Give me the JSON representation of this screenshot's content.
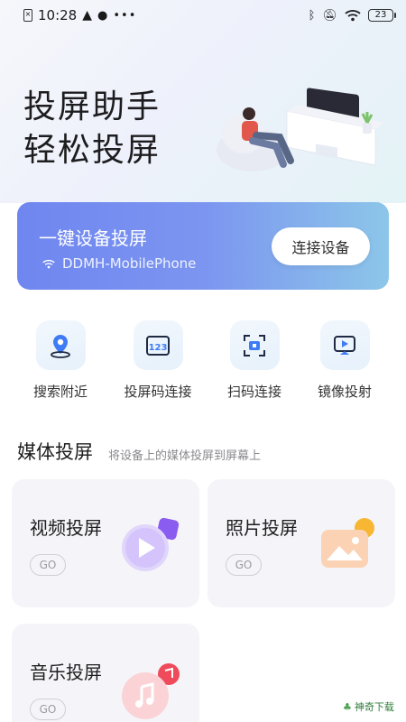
{
  "status_bar": {
    "time": "10:28",
    "battery": "23"
  },
  "hero": {
    "title_line1": "投屏助手",
    "title_line2": "轻松投屏"
  },
  "banner": {
    "title": "一键设备投屏",
    "device": "DDMH-MobilePhone",
    "connect_button": "连接设备"
  },
  "actions": [
    {
      "label": "搜索附近",
      "icon": "location-pin-icon"
    },
    {
      "label": "投屏码连接",
      "icon": "code-123-icon"
    },
    {
      "label": "扫码连接",
      "icon": "scan-icon"
    },
    {
      "label": "镜像投射",
      "icon": "mirror-cast-icon"
    }
  ],
  "section": {
    "title": "媒体投屏",
    "subtitle": "将设备上的媒体投屏到屏幕上"
  },
  "cards": [
    {
      "title": "视频投屏",
      "go": "GO"
    },
    {
      "title": "照片投屏",
      "go": "GO"
    },
    {
      "title": "音乐投屏",
      "go": "GO"
    }
  ],
  "watermark": "神奇下载"
}
